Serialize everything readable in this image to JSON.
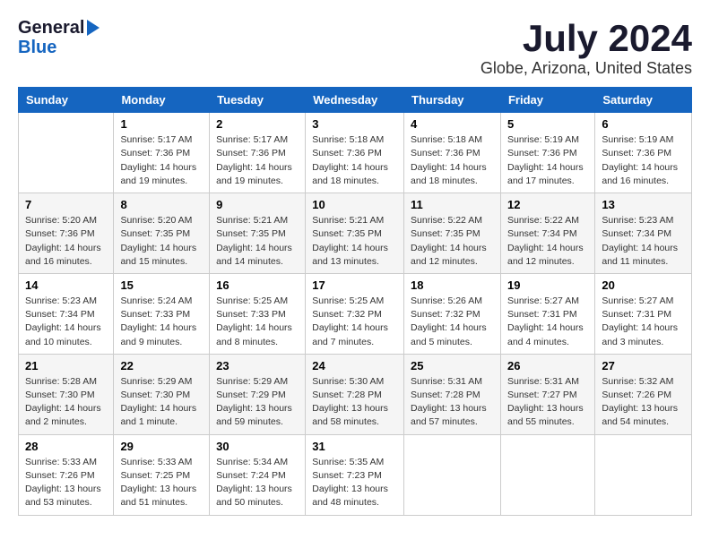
{
  "logo": {
    "general": "General",
    "blue": "Blue"
  },
  "title": "July 2024",
  "subtitle": "Globe, Arizona, United States",
  "headers": [
    "Sunday",
    "Monday",
    "Tuesday",
    "Wednesday",
    "Thursday",
    "Friday",
    "Saturday"
  ],
  "weeks": [
    [
      {
        "day": "",
        "info": ""
      },
      {
        "day": "1",
        "info": "Sunrise: 5:17 AM\nSunset: 7:36 PM\nDaylight: 14 hours\nand 19 minutes."
      },
      {
        "day": "2",
        "info": "Sunrise: 5:17 AM\nSunset: 7:36 PM\nDaylight: 14 hours\nand 19 minutes."
      },
      {
        "day": "3",
        "info": "Sunrise: 5:18 AM\nSunset: 7:36 PM\nDaylight: 14 hours\nand 18 minutes."
      },
      {
        "day": "4",
        "info": "Sunrise: 5:18 AM\nSunset: 7:36 PM\nDaylight: 14 hours\nand 18 minutes."
      },
      {
        "day": "5",
        "info": "Sunrise: 5:19 AM\nSunset: 7:36 PM\nDaylight: 14 hours\nand 17 minutes."
      },
      {
        "day": "6",
        "info": "Sunrise: 5:19 AM\nSunset: 7:36 PM\nDaylight: 14 hours\nand 16 minutes."
      }
    ],
    [
      {
        "day": "7",
        "info": "Sunrise: 5:20 AM\nSunset: 7:36 PM\nDaylight: 14 hours\nand 16 minutes."
      },
      {
        "day": "8",
        "info": "Sunrise: 5:20 AM\nSunset: 7:35 PM\nDaylight: 14 hours\nand 15 minutes."
      },
      {
        "day": "9",
        "info": "Sunrise: 5:21 AM\nSunset: 7:35 PM\nDaylight: 14 hours\nand 14 minutes."
      },
      {
        "day": "10",
        "info": "Sunrise: 5:21 AM\nSunset: 7:35 PM\nDaylight: 14 hours\nand 13 minutes."
      },
      {
        "day": "11",
        "info": "Sunrise: 5:22 AM\nSunset: 7:35 PM\nDaylight: 14 hours\nand 12 minutes."
      },
      {
        "day": "12",
        "info": "Sunrise: 5:22 AM\nSunset: 7:34 PM\nDaylight: 14 hours\nand 12 minutes."
      },
      {
        "day": "13",
        "info": "Sunrise: 5:23 AM\nSunset: 7:34 PM\nDaylight: 14 hours\nand 11 minutes."
      }
    ],
    [
      {
        "day": "14",
        "info": "Sunrise: 5:23 AM\nSunset: 7:34 PM\nDaylight: 14 hours\nand 10 minutes."
      },
      {
        "day": "15",
        "info": "Sunrise: 5:24 AM\nSunset: 7:33 PM\nDaylight: 14 hours\nand 9 minutes."
      },
      {
        "day": "16",
        "info": "Sunrise: 5:25 AM\nSunset: 7:33 PM\nDaylight: 14 hours\nand 8 minutes."
      },
      {
        "day": "17",
        "info": "Sunrise: 5:25 AM\nSunset: 7:32 PM\nDaylight: 14 hours\nand 7 minutes."
      },
      {
        "day": "18",
        "info": "Sunrise: 5:26 AM\nSunset: 7:32 PM\nDaylight: 14 hours\nand 5 minutes."
      },
      {
        "day": "19",
        "info": "Sunrise: 5:27 AM\nSunset: 7:31 PM\nDaylight: 14 hours\nand 4 minutes."
      },
      {
        "day": "20",
        "info": "Sunrise: 5:27 AM\nSunset: 7:31 PM\nDaylight: 14 hours\nand 3 minutes."
      }
    ],
    [
      {
        "day": "21",
        "info": "Sunrise: 5:28 AM\nSunset: 7:30 PM\nDaylight: 14 hours\nand 2 minutes."
      },
      {
        "day": "22",
        "info": "Sunrise: 5:29 AM\nSunset: 7:30 PM\nDaylight: 14 hours\nand 1 minute."
      },
      {
        "day": "23",
        "info": "Sunrise: 5:29 AM\nSunset: 7:29 PM\nDaylight: 13 hours\nand 59 minutes."
      },
      {
        "day": "24",
        "info": "Sunrise: 5:30 AM\nSunset: 7:28 PM\nDaylight: 13 hours\nand 58 minutes."
      },
      {
        "day": "25",
        "info": "Sunrise: 5:31 AM\nSunset: 7:28 PM\nDaylight: 13 hours\nand 57 minutes."
      },
      {
        "day": "26",
        "info": "Sunrise: 5:31 AM\nSunset: 7:27 PM\nDaylight: 13 hours\nand 55 minutes."
      },
      {
        "day": "27",
        "info": "Sunrise: 5:32 AM\nSunset: 7:26 PM\nDaylight: 13 hours\nand 54 minutes."
      }
    ],
    [
      {
        "day": "28",
        "info": "Sunrise: 5:33 AM\nSunset: 7:26 PM\nDaylight: 13 hours\nand 53 minutes."
      },
      {
        "day": "29",
        "info": "Sunrise: 5:33 AM\nSunset: 7:25 PM\nDaylight: 13 hours\nand 51 minutes."
      },
      {
        "day": "30",
        "info": "Sunrise: 5:34 AM\nSunset: 7:24 PM\nDaylight: 13 hours\nand 50 minutes."
      },
      {
        "day": "31",
        "info": "Sunrise: 5:35 AM\nSunset: 7:23 PM\nDaylight: 13 hours\nand 48 minutes."
      },
      {
        "day": "",
        "info": ""
      },
      {
        "day": "",
        "info": ""
      },
      {
        "day": "",
        "info": ""
      }
    ]
  ]
}
